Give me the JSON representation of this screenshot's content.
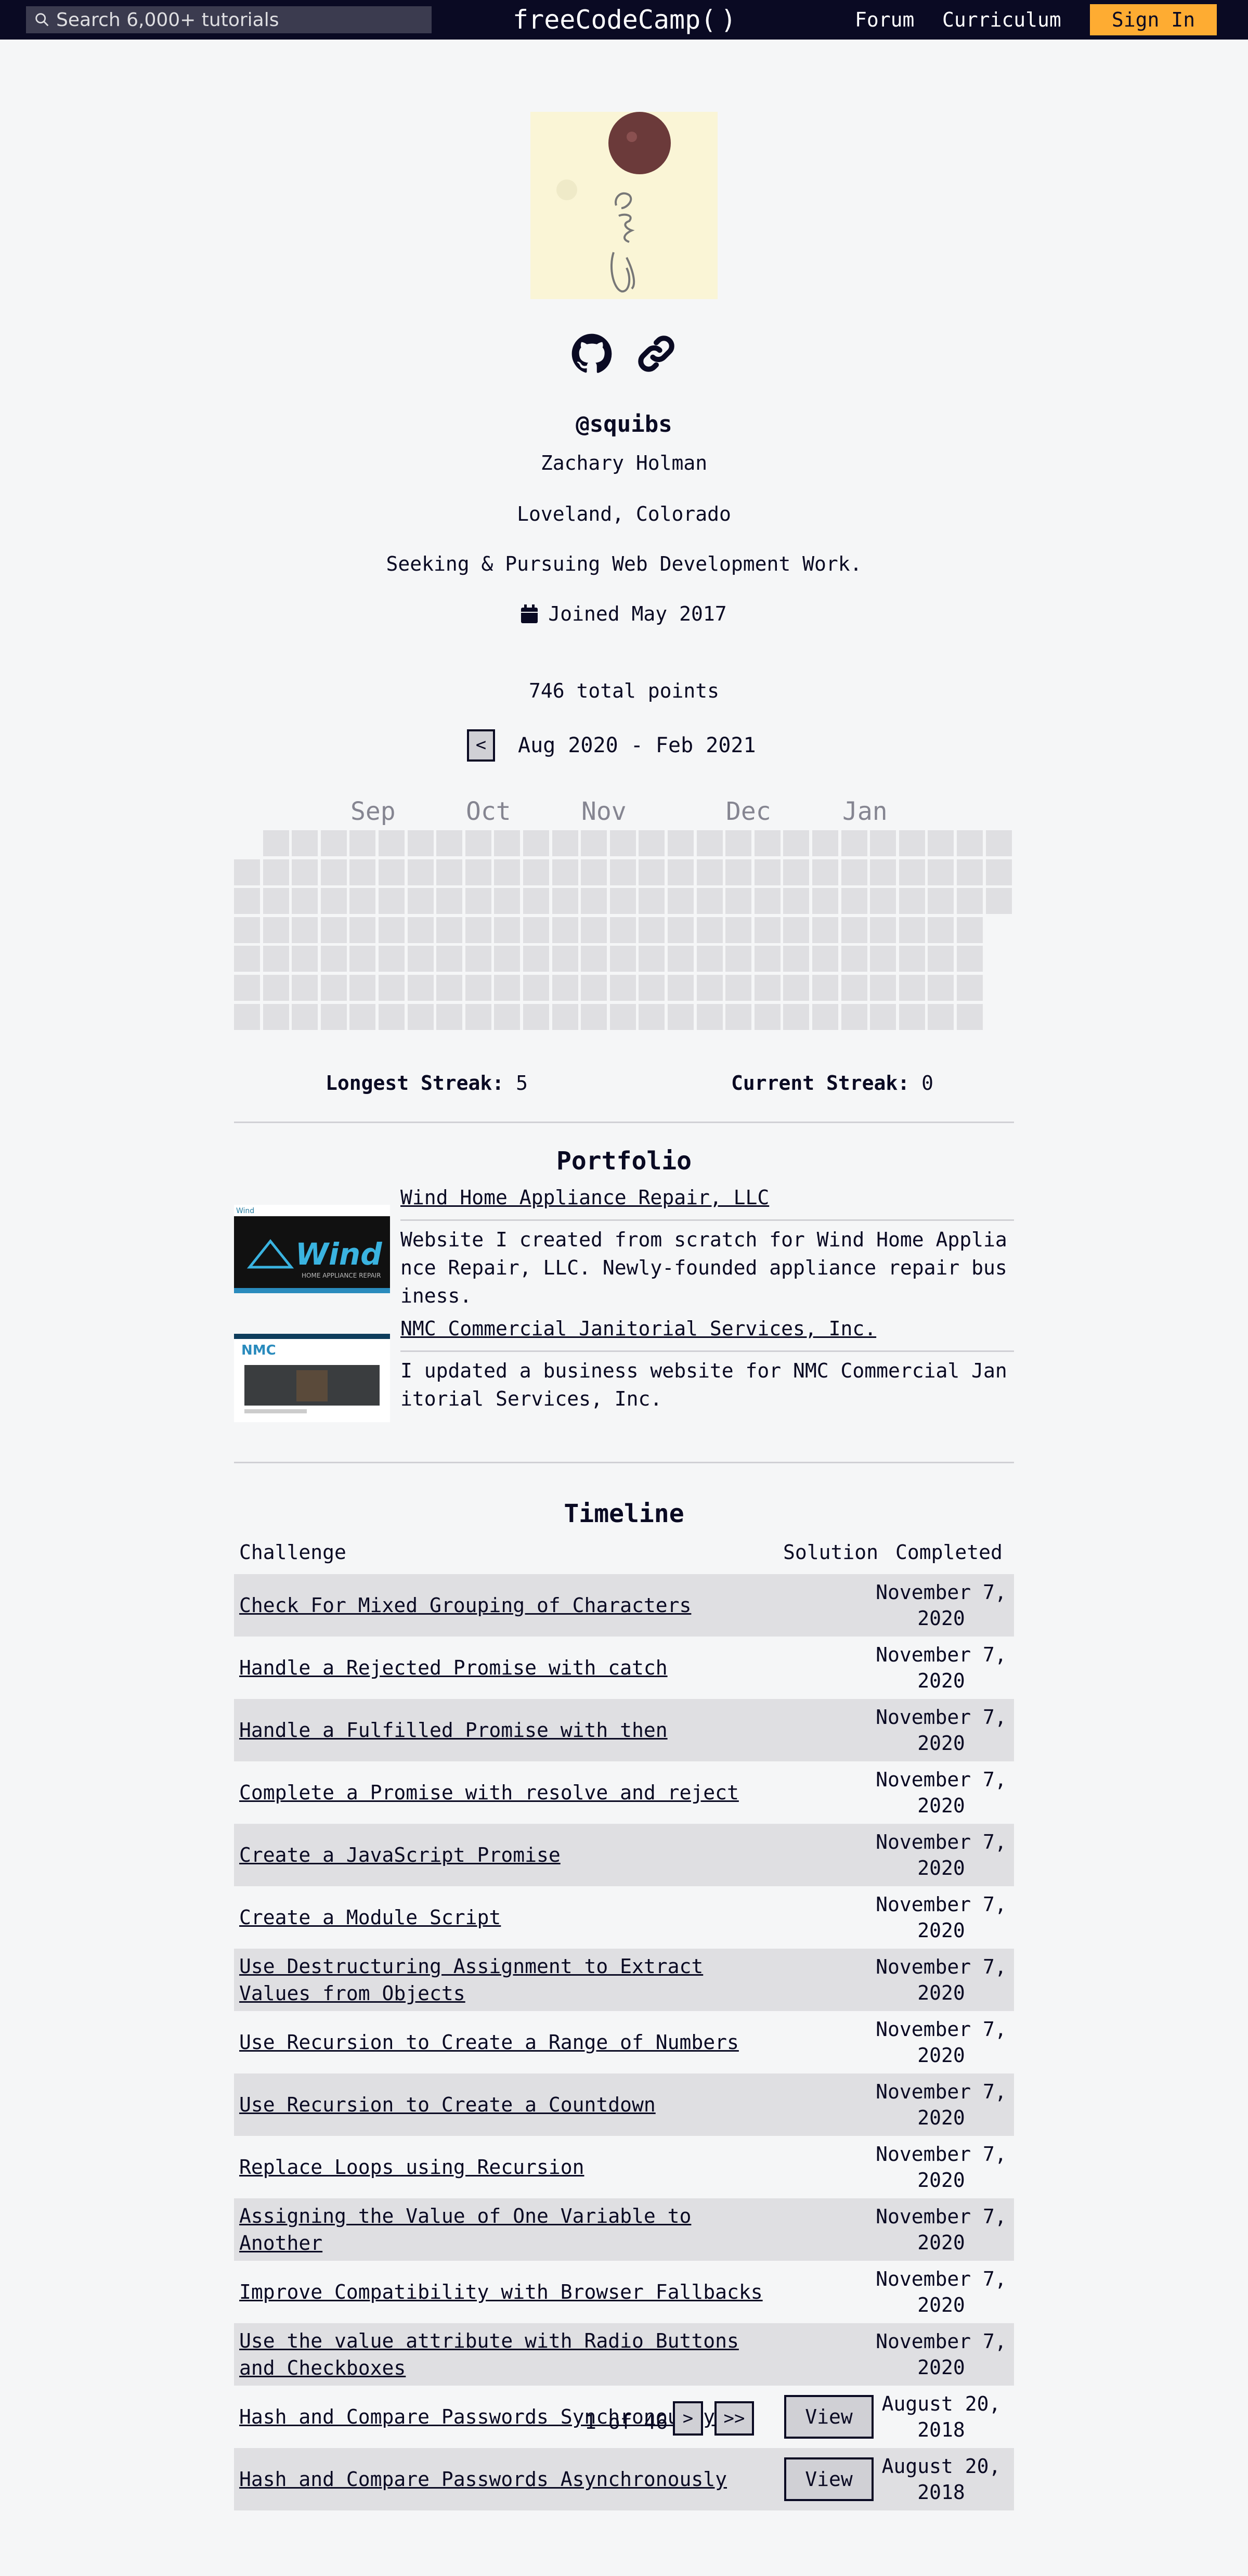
{
  "nav": {
    "search_placeholder": "Search 6,000+ tutorials",
    "logo_left": "freeCodeCamp(",
    "logo_right": ")",
    "forum": "Forum",
    "curriculum": "Curriculum",
    "sign_in": "Sign In"
  },
  "profile": {
    "username": "@squibs",
    "name": "Zachary Holman",
    "location": "Loveland, Colorado",
    "bio": "Seeking & Pursuing Web Development Work.",
    "joined": "Joined May 2017",
    "points": "746 total points"
  },
  "heatmap": {
    "prev_button": "<",
    "range": "Aug 2020 - Feb 2021",
    "months": [
      "Sep",
      "Oct",
      "Nov",
      "Dec",
      "Jan"
    ],
    "longest_streak_label": "Longest Streak:",
    "longest_streak_value": "5",
    "current_streak_label": "Current Streak:",
    "current_streak_value": "0"
  },
  "portfolio": {
    "title": "Portfolio",
    "items": [
      {
        "title": "Wind Home Appliance Repair, LLC",
        "description": "Website I created from scratch for Wind Home Appliance Repair, LLC. Newly-founded appliance repair business.",
        "image_text": "Wind",
        "image_subtext": "HOME APPLIANCE REPAIR"
      },
      {
        "title": "NMC Commercial Janitorial Services, Inc.",
        "description": "I updated a business website for NMC Commercial Janitorial Services, Inc.",
        "image_text": "NMC"
      }
    ]
  },
  "timeline": {
    "title": "Timeline",
    "headers": {
      "challenge": "Challenge",
      "solution": "Solution",
      "completed": "Completed"
    },
    "view_label": "View",
    "rows": [
      {
        "challenge": "Check For Mixed Grouping of Characters",
        "date": "November 7, 2020",
        "solution": ""
      },
      {
        "challenge": "Handle a Rejected Promise with catch",
        "date": "November 7, 2020",
        "solution": ""
      },
      {
        "challenge": "Handle a Fulfilled Promise with then",
        "date": "November 7, 2020",
        "solution": ""
      },
      {
        "challenge": "Complete a Promise with resolve and reject",
        "date": "November 7, 2020",
        "solution": ""
      },
      {
        "challenge": "Create a JavaScript Promise",
        "date": "November 7, 2020",
        "solution": ""
      },
      {
        "challenge": "Create a Module Script",
        "date": "November 7, 2020",
        "solution": ""
      },
      {
        "challenge": "Use Destructuring Assignment to Extract Values from Objects",
        "date": "November 7, 2020",
        "solution": ""
      },
      {
        "challenge": "Use Recursion to Create a Range of Numbers",
        "date": "November 7, 2020",
        "solution": ""
      },
      {
        "challenge": "Use Recursion to Create a Countdown",
        "date": "November 7, 2020",
        "solution": ""
      },
      {
        "challenge": "Replace Loops using Recursion",
        "date": "November 7, 2020",
        "solution": ""
      },
      {
        "challenge": "Assigning the Value of One Variable to Another",
        "date": "November 7, 2020",
        "solution": ""
      },
      {
        "challenge": "Improve Compatibility with Browser Fallbacks",
        "date": "November 7, 2020",
        "solution": ""
      },
      {
        "challenge": "Use the value attribute with Radio Buttons and Checkboxes",
        "date": "November 7, 2020",
        "solution": ""
      },
      {
        "challenge": "Hash and Compare Passwords Synchronously",
        "date": "August 20, 2018",
        "solution": "View"
      },
      {
        "challenge": "Hash and Compare Passwords Asynchronously",
        "date": "August 20, 2018",
        "solution": "View"
      }
    ],
    "pagination": {
      "text": "1 of 46",
      "next": ">",
      "last": ">>"
    }
  },
  "colors": {
    "nav_bg": "#0a0a23",
    "page_bg": "#f5f6f7",
    "accent": "#feac32",
    "cell_empty": "#dfdfe2",
    "row_shade": "#dfdfe2"
  },
  "icons": [
    "search-icon",
    "flame-icon",
    "github-icon",
    "link-icon",
    "calendar-icon"
  ]
}
